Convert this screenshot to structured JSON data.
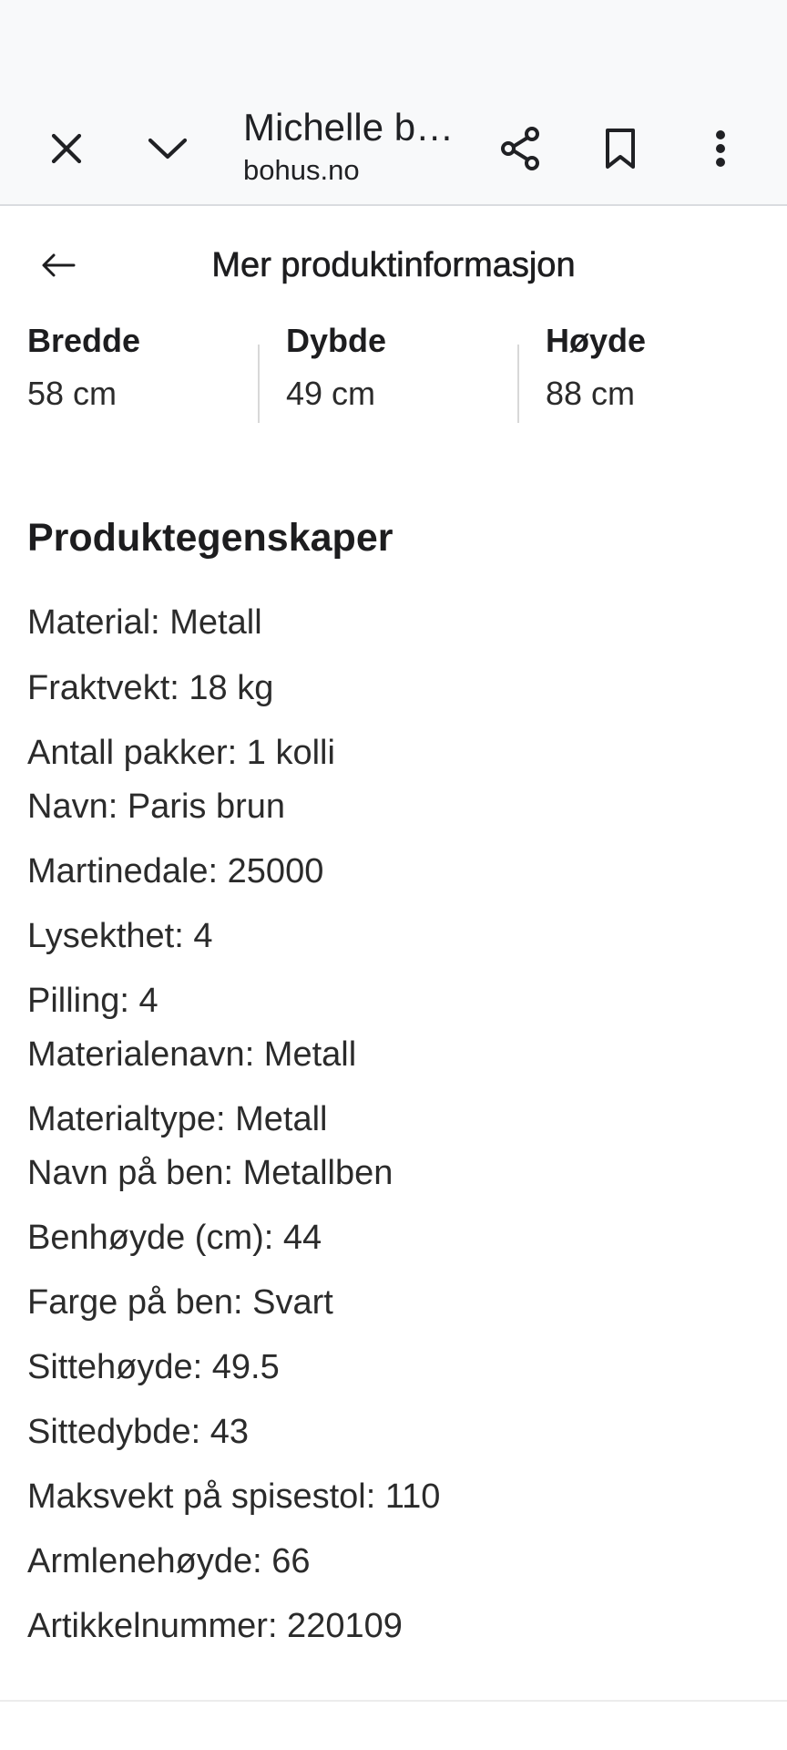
{
  "toolbar": {
    "title": "Michelle b…",
    "domain": "bohus.no"
  },
  "panel": {
    "title": "Mer produktinformasjon"
  },
  "dimensions": [
    {
      "label": "Bredde",
      "value": "58 cm"
    },
    {
      "label": "Dybde",
      "value": "49 cm"
    },
    {
      "label": "Høyde",
      "value": "88 cm"
    }
  ],
  "properties": {
    "title": "Produktegenskaper",
    "items": [
      "Material: Metall",
      "Fraktvekt: 18 kg",
      "Antall pakker: 1 kolli",
      "Navn: Paris brun",
      "Martinedale: 25000",
      "Lysekthet: 4",
      "Pilling: 4",
      "Materialenavn: Metall",
      "Materialtype: Metall",
      "Navn på ben: Metallben",
      "Benhøyde (cm): 44",
      "Farge på ben: Svart",
      "Sittehøyde: 49.5",
      "Sittedybde: 43",
      "Maksvekt på spisestol: 110",
      "Armlenehøyde: 66",
      "Artikkelnummer: 220109"
    ]
  },
  "icons": {
    "close": "close-icon",
    "minimize": "chevron-down-icon",
    "share": "share-icon",
    "bookmark": "bookmark-icon",
    "more": "more-vert-icon",
    "back": "arrow-left-icon"
  }
}
